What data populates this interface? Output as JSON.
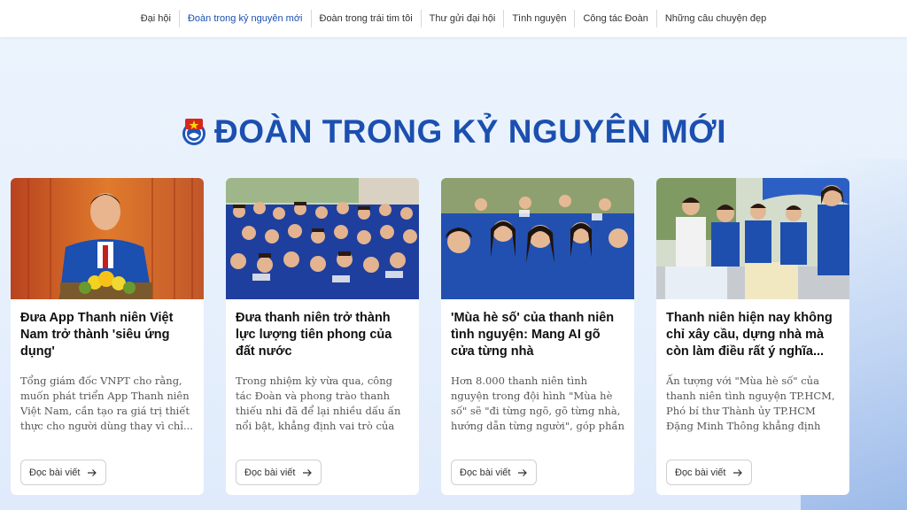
{
  "nav": {
    "items": [
      {
        "label": "Đại hội"
      },
      {
        "label": "Đoàn trong kỷ nguyên mới",
        "active": true
      },
      {
        "label": "Đoàn trong trái tim tôi"
      },
      {
        "label": "Thư gửi đại hội"
      },
      {
        "label": "Tình nguyện"
      },
      {
        "label": "Công tác Đoàn"
      },
      {
        "label": "Những câu chuyện đẹp"
      }
    ]
  },
  "section": {
    "title": "ĐOÀN TRONG KỶ NGUYÊN MỚI",
    "emblem_icon": "youth-union-emblem-icon"
  },
  "colors": {
    "accent": "#1b4fb0",
    "background": "#e8f1fc"
  },
  "articles": [
    {
      "title": "Đưa App Thanh niên Việt Nam trở thành 'siêu ứng dụng'",
      "description": "Tổng giám đốc VNPT cho rằng, muốn phát triển App Thanh niên Việt Nam, cần tạo ra giá trị thiết thực cho người dùng thay vì chỉ...",
      "button": "Đọc bài viết",
      "image_icon": "speaker-at-podium-photo"
    },
    {
      "title": "Đưa thanh niên trở thành lực lượng tiên phong của đất nước",
      "description": "Trong nhiệm kỳ vừa qua, công tác Đoàn và phong trào thanh thiếu nhi đã để lại nhiều dấu ấn nổi bật, khẳng định vai trò của tuổi trẻ VN...",
      "button": "Đọc bài viết",
      "image_icon": "youth-crowd-photo"
    },
    {
      "title": "'Mùa hè số' của thanh niên tình nguyện: Mang AI gõ cửa từng nhà",
      "description": "Hơn 8.000 thanh niên tình nguyện trong đội hình \"Mùa hè số\" sẽ \"đi từng ngõ, gõ từng nhà, hướng dẫn từng người\", góp phần đưa mục ti...",
      "button": "Đọc bài viết",
      "image_icon": "volunteers-group-photo"
    },
    {
      "title": "Thanh niên hiện nay không chỉ xây cầu, dựng nhà mà còn làm điều rất ý nghĩa...",
      "description": "Ấn tượng với \"Mùa hè số\" của thanh niên tình nguyện TP.HCM, Phó bí thư Thành ủy TP.HCM Đặng Minh Thông khẳng định thanh...",
      "button": "Đọc bài viết",
      "image_icon": "outdoor-booth-photo"
    }
  ]
}
